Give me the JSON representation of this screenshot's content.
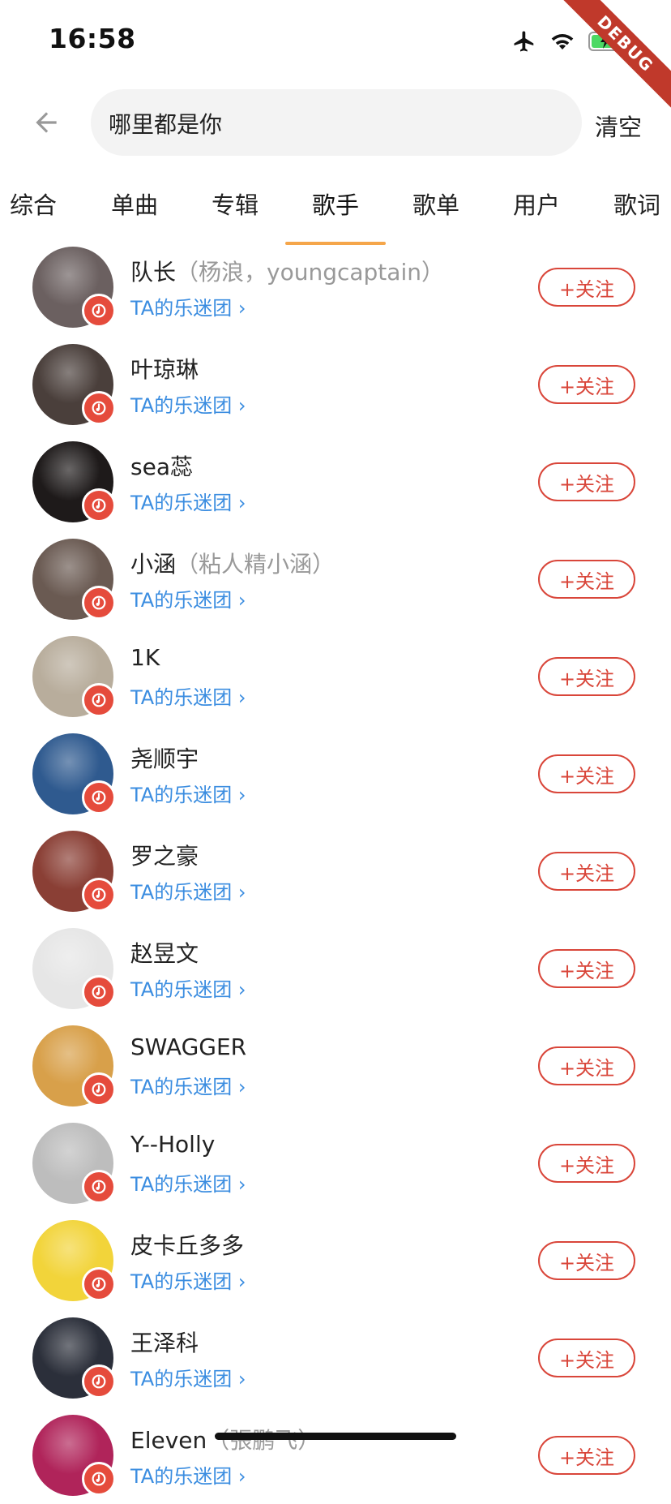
{
  "status_bar": {
    "time": "16:58",
    "debug_label": "DEBUG"
  },
  "search": {
    "query": "哪里都是你",
    "clear_label": "清空"
  },
  "tabs": [
    {
      "label": "综合"
    },
    {
      "label": "单曲"
    },
    {
      "label": "专辑"
    },
    {
      "label": "歌手"
    },
    {
      "label": "歌单"
    },
    {
      "label": "用户"
    },
    {
      "label": "歌词"
    }
  ],
  "active_tab": "歌手",
  "fan_link_label": "TA的乐迷团 ›",
  "follow_label": "+关注",
  "artists": [
    {
      "name": "队长",
      "alias": "（杨浪，youngcaptain）",
      "avatar_color": "#6b6060"
    },
    {
      "name": "叶琼琳",
      "alias": "",
      "avatar_color": "#4a3f3b"
    },
    {
      "name": "sea蕊",
      "alias": "",
      "avatar_color": "#1e1a1a"
    },
    {
      "name": "小涵",
      "alias": "（粘人精小涵）",
      "avatar_color": "#6a5a52"
    },
    {
      "name": "1K",
      "alias": "",
      "avatar_color": "#b8ad9c"
    },
    {
      "name": "尧顺宇",
      "alias": "",
      "avatar_color": "#2f5a8f"
    },
    {
      "name": "罗之豪",
      "alias": "",
      "avatar_color": "#8a3f35"
    },
    {
      "name": "赵昱文",
      "alias": "",
      "avatar_color": "#e6e6e6"
    },
    {
      "name": "SWAGGER",
      "alias": "",
      "avatar_color": "#d8a04a"
    },
    {
      "name": "Y--Holly",
      "alias": "",
      "avatar_color": "#bdbdbd"
    },
    {
      "name": "皮卡丘多多",
      "alias": "",
      "avatar_color": "#f2d43a"
    },
    {
      "name": "王泽科",
      "alias": "",
      "avatar_color": "#2b2f3a"
    },
    {
      "name": "Eleven",
      "alias": "（張鹏飞）",
      "avatar_color": "#b0245a"
    }
  ],
  "colors": {
    "accent_red": "#d9463a",
    "link_blue": "#3b8de0",
    "tab_indicator": "#f5a64a"
  }
}
